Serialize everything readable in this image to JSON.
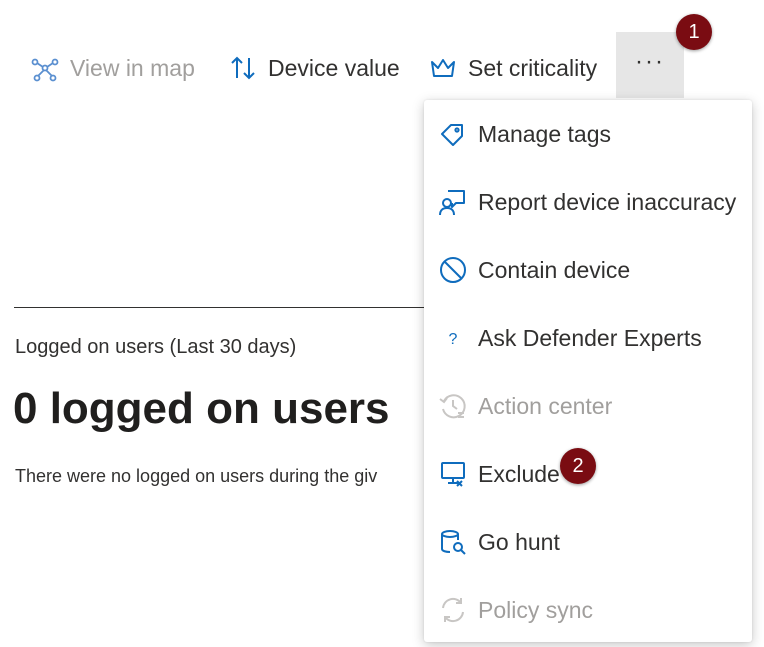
{
  "toolbar": {
    "view_in_map": "View in map",
    "device_value": "Device value",
    "set_criticality": "Set criticality",
    "more_label": "···"
  },
  "callouts": {
    "first": "1",
    "second": "2"
  },
  "section": {
    "title": "Logged on users (Last 30 days)",
    "count_text": "0 logged on users",
    "note": "There were no logged on users during the giv"
  },
  "menu": {
    "items": [
      {
        "label": "Manage tags",
        "icon": "tag-icon",
        "enabled": true
      },
      {
        "label": "Report device inaccuracy",
        "icon": "report-person-icon",
        "enabled": true
      },
      {
        "label": "Contain device",
        "icon": "block-icon",
        "enabled": true
      },
      {
        "label": "Ask Defender Experts",
        "icon": "question-icon",
        "enabled": true
      },
      {
        "label": "Action center",
        "icon": "history-icon",
        "enabled": false
      },
      {
        "label": "Exclude",
        "icon": "monitor-x-icon",
        "enabled": true
      },
      {
        "label": "Go hunt",
        "icon": "database-search-icon",
        "enabled": true
      },
      {
        "label": "Policy sync",
        "icon": "sync-icon",
        "enabled": false
      }
    ]
  },
  "colors": {
    "accent": "#0f6cbd",
    "callout": "#7a0c12",
    "disabled": "#a19f9d",
    "text": "#323130"
  }
}
